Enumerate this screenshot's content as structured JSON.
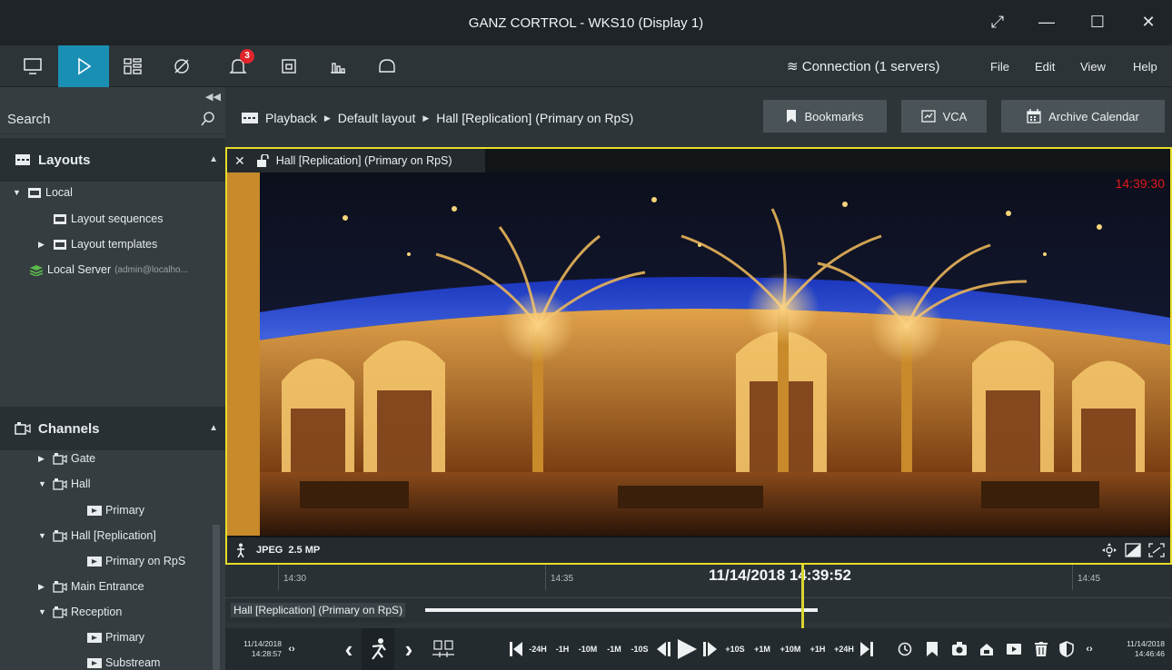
{
  "window": {
    "title": "GANZ CORTROL - WKS10 (Display 1)",
    "controls": [
      "restore-icon",
      "minimize-icon",
      "maximize-icon",
      "close-icon"
    ]
  },
  "toolbar": {
    "tools": [
      {
        "name": "monitor-icon"
      },
      {
        "name": "playback-icon",
        "active": true
      },
      {
        "name": "layout-grid-icon"
      },
      {
        "name": "vca-icon"
      },
      {
        "name": "alarm-bell-icon",
        "badge": "3"
      },
      {
        "name": "archive-icon"
      },
      {
        "name": "statistics-icon"
      },
      {
        "name": "chat-icon"
      }
    ],
    "connection": "Connection (1 servers)",
    "menu": [
      "File",
      "Edit",
      "View",
      "Help"
    ],
    "accent_color": "#1a8fb4",
    "badge_color": "#e0262b"
  },
  "sidebar": {
    "search": {
      "placeholder": "Search"
    },
    "layouts": {
      "title": "Layouts",
      "items": [
        {
          "label": "Local",
          "expanded": true
        },
        {
          "label": "Layout sequences"
        },
        {
          "label": "Layout templates",
          "expanded": false
        },
        {
          "label": "Local Server",
          "sub": "(admin@localho..."
        }
      ]
    },
    "channels": {
      "title": "Channels",
      "items": [
        {
          "label": "Gate",
          "expanded": false
        },
        {
          "label": "Hall",
          "expanded": true
        },
        {
          "label": "Primary"
        },
        {
          "label": "Hall [Replication]",
          "expanded": true
        },
        {
          "label": "Primary on RpS"
        },
        {
          "label": "Main Entrance",
          "expanded": false
        },
        {
          "label": "Reception",
          "expanded": true
        },
        {
          "label": "Primary"
        },
        {
          "label": "Substream"
        }
      ]
    }
  },
  "main": {
    "breadcrumb": [
      "Playback",
      "Default layout",
      "Hall [Replication] (Primary on RpS)"
    ],
    "buttons": {
      "bookmarks": "Bookmarks",
      "vca": "VCA",
      "archive_calendar": "Archive Calendar"
    },
    "video": {
      "title": "Hall [Replication] (Primary on RpS)",
      "timestamp": "14:39:30",
      "codec": "JPEG",
      "resolution": "2.5 MP",
      "frame_color": "#e6dd2a"
    },
    "timeline": {
      "ticks": [
        "14:30",
        "14:35",
        "14:45"
      ],
      "current_date": "11/14/2018",
      "current_time": "14:39:52",
      "track_label": "Hall [Replication] (Primary on RpS)"
    },
    "playback": {
      "start_date": "11/14/2018",
      "start_time": "14:28:57",
      "end_date": "11/14/2018",
      "end_time": "14:46:46",
      "steps_back": [
        "-24H",
        "-1H",
        "-10M",
        "-1M",
        "-10S"
      ],
      "steps_forward": [
        "+10S",
        "+1M",
        "+10M",
        "+1H",
        "+24H"
      ]
    }
  }
}
